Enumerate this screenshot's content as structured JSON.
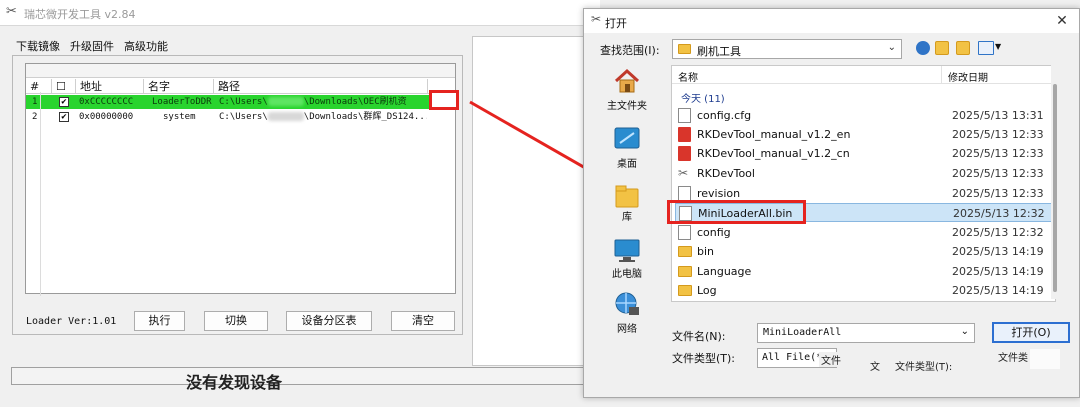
{
  "main": {
    "title": "瑞芯微开发工具 v2.84",
    "tabs": [
      {
        "label": "下载镜像"
      },
      {
        "label": "升级固件"
      },
      {
        "label": "高级功能"
      }
    ],
    "columns": [
      "#",
      "☐",
      "地址",
      "名字",
      "路径"
    ],
    "rows": [
      {
        "num": "1",
        "checked": "✔",
        "address": "0xCCCCCCCC",
        "name": "LoaderToDDR",
        "path_start": "C:\\Users\\",
        "path_end": "\\Downloads\\OEC刷机资"
      },
      {
        "num": "2",
        "checked": "✔",
        "address": "0x00000000",
        "name": "system",
        "path_start": "C:\\Users\\",
        "path_end": "\\Downloads\\群辉_DS124..."
      }
    ],
    "loader_version": "Loader Ver:1.01",
    "buttons": {
      "execute": "执行",
      "switch": "切换",
      "partition": "设备分区表",
      "clear": "清空"
    },
    "status": "没有发现设备"
  },
  "dialog": {
    "title": "打开",
    "close_glyph": "✕",
    "look_in_label": "查找范围(I):",
    "look_in_value": "刷机工具",
    "places": [
      "主文件夹",
      "桌面",
      "库",
      "此电脑",
      "网络"
    ],
    "header_name": "名称",
    "header_date": "修改日期",
    "group": "今天 (11)",
    "files": [
      {
        "name": "config.cfg",
        "date": "2025/5/13 13:31",
        "icon": "doc-icon"
      },
      {
        "name": "RKDevTool_manual_v1.2_en",
        "date": "2025/5/13 12:33",
        "icon": "pdf-icon"
      },
      {
        "name": "RKDevTool_manual_v1.2_cn",
        "date": "2025/5/13 12:33",
        "icon": "pdf-icon"
      },
      {
        "name": "RKDevTool",
        "date": "2025/5/13 12:33",
        "icon": "app-icon"
      },
      {
        "name": "revision",
        "date": "2025/5/13 12:33",
        "icon": "doc-icon"
      },
      {
        "name": "MiniLoaderAll.bin",
        "date": "2025/5/13 12:32",
        "icon": "doc-icon"
      },
      {
        "name": "config",
        "date": "2025/5/13 12:32",
        "icon": "settings-icon"
      },
      {
        "name": "bin",
        "date": "2025/5/13 14:19",
        "icon": "folder-icon"
      },
      {
        "name": "Language",
        "date": "2025/5/13 14:19",
        "icon": "folder-icon"
      },
      {
        "name": "Log",
        "date": "2025/5/13 14:19",
        "icon": "folder-icon"
      }
    ],
    "filename_label": "文件名(N):",
    "filename_value": "MiniLoaderAll",
    "open_label": "打开(O)",
    "filetype_label": "文件类型(T):",
    "filetype_value": "All File(*.*)",
    "ghost_text": [
      "文件",
      "文",
      "文件类型(T):",
      "文件类"
    ]
  },
  "colors": {
    "highlight_row": "#29d42e",
    "annotation_red": "#e5231f",
    "selected_file": "#cce4f7"
  }
}
